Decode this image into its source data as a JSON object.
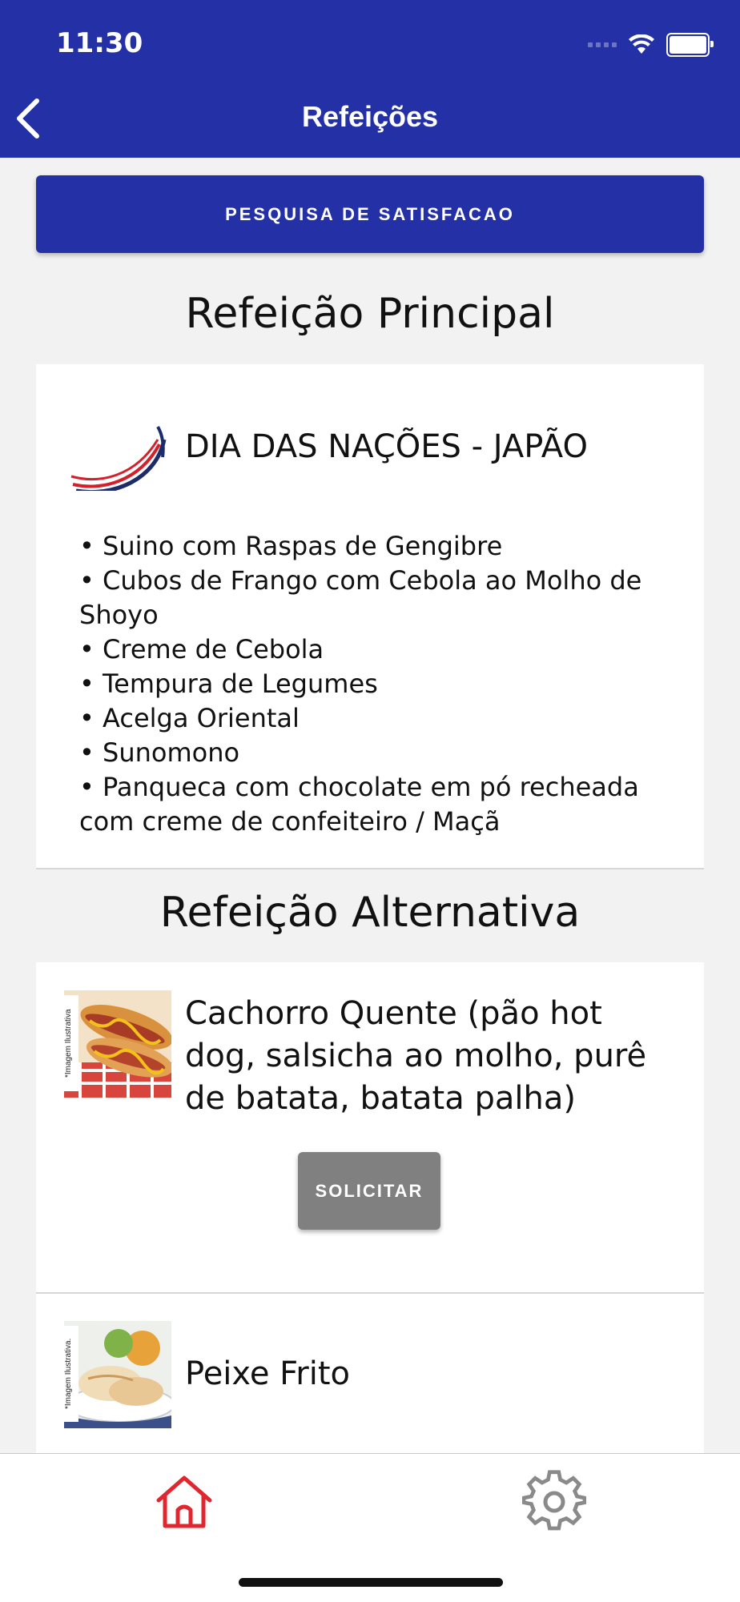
{
  "status_bar": {
    "time": "11:30"
  },
  "header": {
    "title": "Refeições"
  },
  "survey_button": {
    "label": "PESQUISA DE SATISFACAO"
  },
  "main_meal": {
    "section_title": "Refeição Principal",
    "name": "DIA DAS NAÇÕES - JAPÃO",
    "items": [
      "• Suino com Raspas de Gengibre",
      "• Cubos de Frango com Cebola ao Molho de Shoyo",
      "• Creme de Cebola",
      "• Tempura de Legumes",
      "• Acelga Oriental",
      "• Sunomono",
      "• Panqueca com chocolate em pó recheada com creme de confeiteiro /  Maçã"
    ]
  },
  "alternative_meal": {
    "section_title": "Refeição Alternativa",
    "items": [
      {
        "name": "Cachorro Quente (pão hot dog, salsicha ao molho, purê de batata, batata palha)",
        "image_caption": "*Imagem Ilustrativa",
        "request_label": "SOLICITAR"
      },
      {
        "name": "Peixe Frito",
        "image_caption": "*Imagem Ilustrativa."
      }
    ]
  },
  "tab_bar": {
    "active_color": "#e0262e",
    "inactive_color": "#8a8a8a",
    "tabs": [
      "home-icon",
      "gear-icon"
    ]
  },
  "colors": {
    "brand_blue": "#2430a6",
    "disabled_gray": "#808080"
  }
}
